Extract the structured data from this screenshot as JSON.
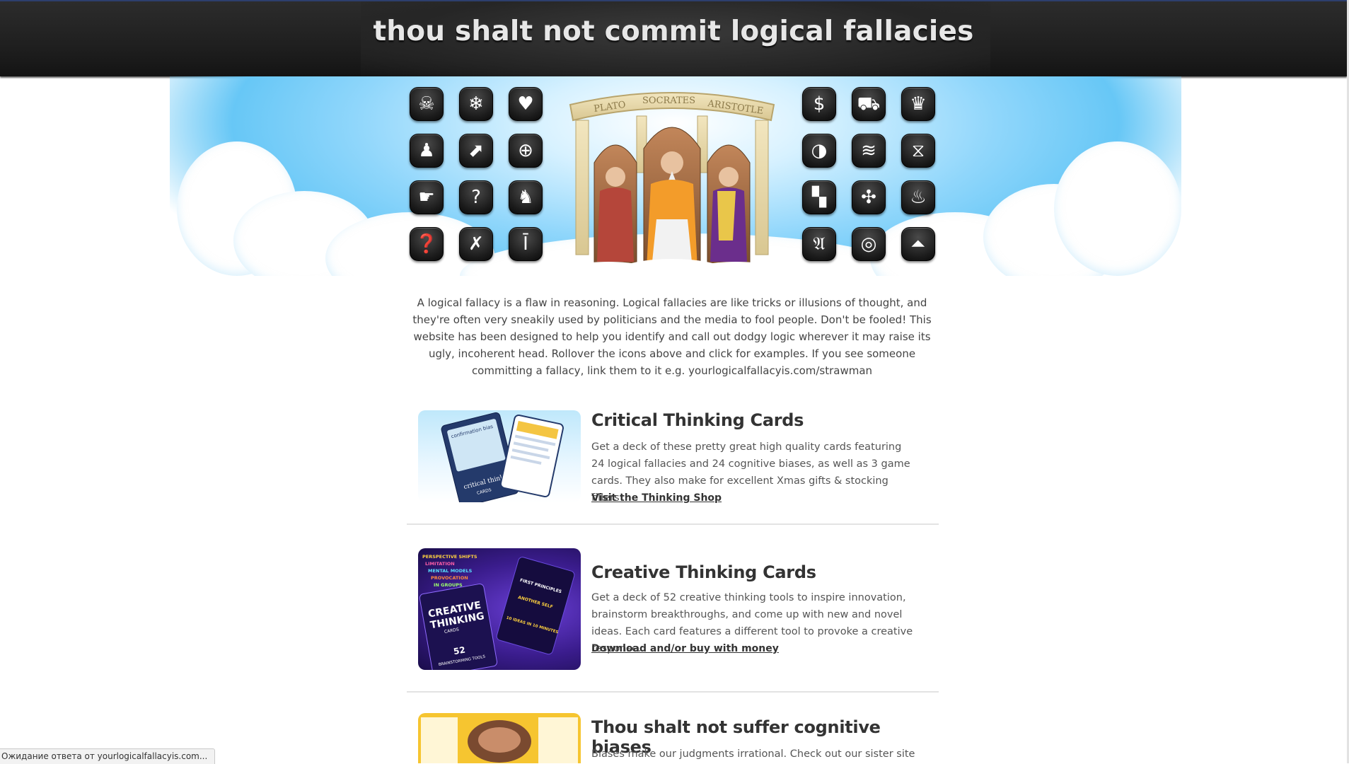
{
  "site": {
    "title": "thou shalt not commit logical fallacies"
  },
  "icons": {
    "left": [
      "skull-hat",
      "snowflake-skull",
      "heart",
      "top-hat",
      "escape",
      "crosshair",
      "pointing-hand",
      "question-mark",
      "kneeling-figure",
      "question-ball",
      "running-figure",
      "goblet"
    ],
    "right": [
      "dollar-clock",
      "cart",
      "crown",
      "mask",
      "wave",
      "dna",
      "checker",
      "swirl",
      "flame",
      "gothic-a",
      "target",
      "tent"
    ]
  },
  "philosophers": {
    "arch": [
      "PLATO",
      "SOCRATES",
      "ARISTOTLE"
    ]
  },
  "intro": {
    "text": "A logical fallacy is a flaw in reasoning. Logical fallacies are like tricks or illusions of thought, and they're often very sneakily used by politicians and the media to fool people. Don't be fooled! This website has been designed to help you identify and call out dodgy logic wherever it may raise its ugly, incoherent head. Rollover the icons above and click for examples. If you see someone committing a fallacy, link them to it e.g. yourlogicalfallacyis.com/strawman"
  },
  "promos": [
    {
      "title": "Critical Thinking Cards",
      "body": "Get a deck of these pretty great high quality cards featuring 24 logical fallacies and 24 cognitive biases, as well as 3 game cards. They also make for excellent Xmas gifts & stocking fillers!",
      "link": "Visit the Thinking Shop"
    },
    {
      "title": "Creative Thinking Cards",
      "body": "Get a deck of 52 creative thinking tools to inspire innovation, brainstorm breakthroughs, and come up with new and novel ideas. Each card features a different tool to provoke a creative response.",
      "link": "Download and/or buy with money"
    },
    {
      "title": "Thou shalt not suffer cognitive biases",
      "body": "Biases make our judgments irrational. Check out our sister site"
    }
  ],
  "thumbs": {
    "critical": {
      "label": "critical thinking",
      "sub": "CARDS",
      "card": "confirmation bias"
    },
    "creative": {
      "line1": "CREATIVE",
      "line2": "THINKING",
      "line3": "CARDS",
      "count": "52",
      "sub": "BRAINSTORMING TOOLS",
      "side1": "FIRST PRINCIPLES",
      "side2": "ANOTHER SELF",
      "side3": "10 IDEAS IN 10 MINUTES",
      "tags": [
        "PERSPECTIVE SHIFTS",
        "LIMITATION",
        "MENTAL MODELS",
        "PROVOCATION",
        "IN GROUPS"
      ]
    }
  },
  "status": {
    "text": "Ожидание ответа от yourlogicalfallacyis.com..."
  },
  "colors": {
    "header": "#1f1f1f",
    "sky": "#67c7f6",
    "text": "#444444",
    "heading": "#333333"
  }
}
